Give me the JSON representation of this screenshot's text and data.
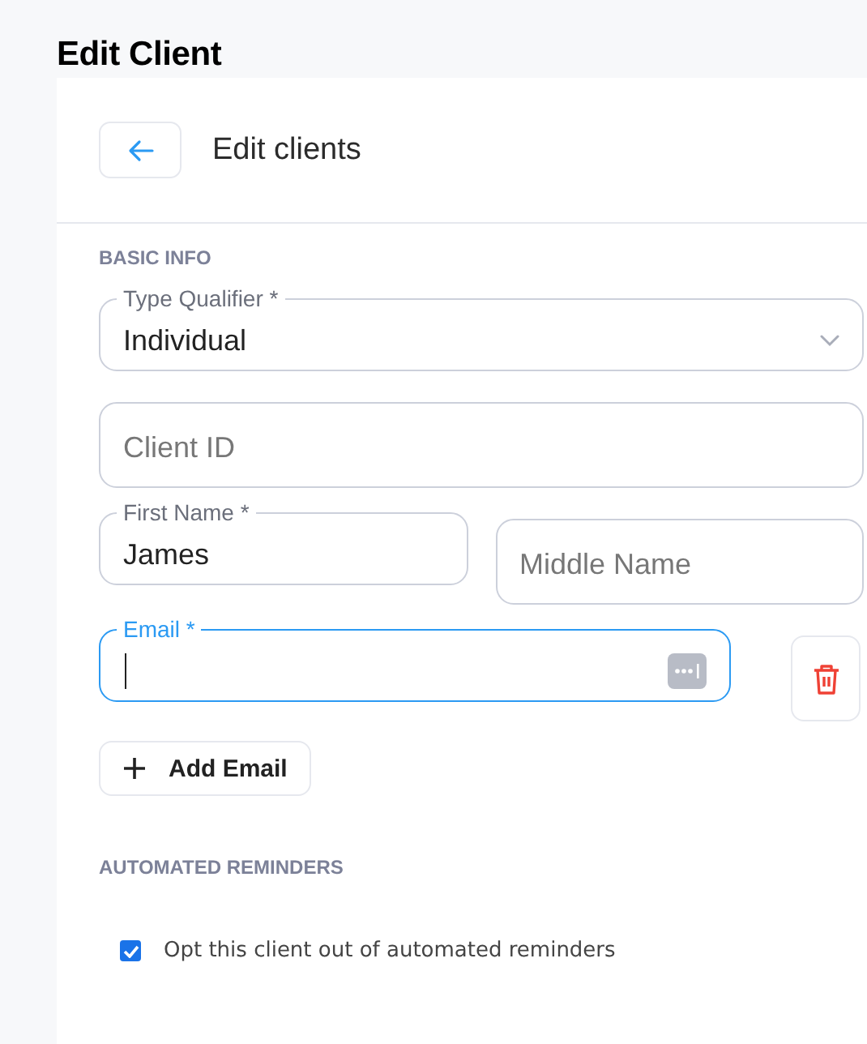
{
  "page": {
    "title": "Edit Client"
  },
  "header": {
    "title": "Edit clients"
  },
  "sections": [
    {
      "heading": "BASIC INFO",
      "rows": [
        [
          {
            "kind": "select",
            "label": "Type Qualifier *",
            "value": "Individual",
            "focused": false
          }
        ],
        [
          {
            "kind": "text",
            "placeholder": "Client ID",
            "focused": false
          }
        ],
        [
          {
            "kind": "text",
            "label": "First Name *",
            "value": "James",
            "focused": false
          },
          {
            "kind": "text",
            "placeholder": "Middle Name",
            "focused": false
          }
        ],
        [
          {
            "kind": "email",
            "label": "Email *",
            "focused": true
          }
        ]
      ],
      "add_button": "Add Email"
    },
    {
      "heading": "AUTOMATED REMINDERS",
      "options": [
        {
          "label": "Opt this client out of automated reminders",
          "checked": true
        }
      ]
    }
  ]
}
